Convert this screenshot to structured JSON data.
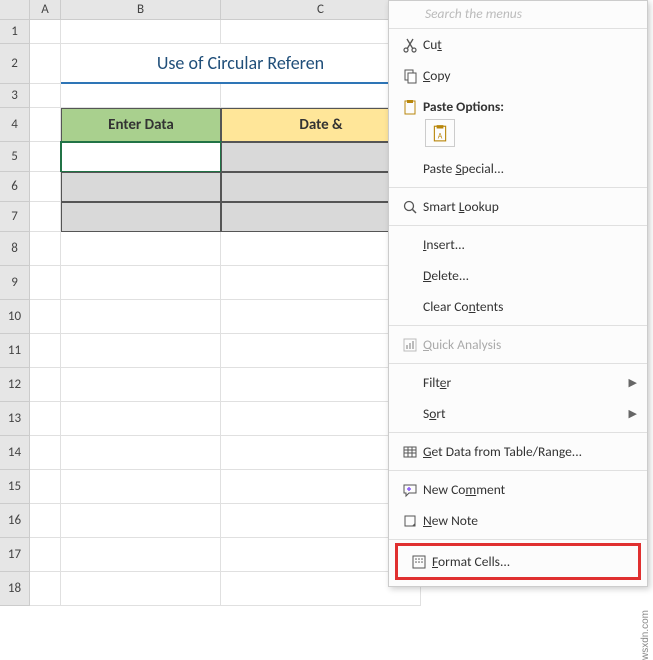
{
  "columns": [
    "A",
    "B",
    "C"
  ],
  "rows": [
    1,
    2,
    3,
    4,
    5,
    6,
    7,
    8,
    9,
    10,
    11,
    12,
    13,
    14,
    15,
    16,
    17,
    18
  ],
  "title": "Use of Circular Referen",
  "table": {
    "headers": {
      "b": "Enter Data",
      "c": "Date &"
    }
  },
  "menu": {
    "search_placeholder": "Search the menus",
    "cut": "Cut",
    "copy": "Copy",
    "paste_options": "Paste Options:",
    "paste_special": "Paste Special...",
    "smart_lookup": "Smart Lookup",
    "insert": "Insert...",
    "delete": "Delete...",
    "clear_contents": "Clear Contents",
    "quick_analysis": "Quick Analysis",
    "filter": "Filter",
    "sort": "Sort",
    "get_data": "Get Data from Table/Range...",
    "new_comment": "New Comment",
    "new_note": "New Note",
    "format_cells": "Format Cells..."
  },
  "underlines": {
    "cut": "t",
    "copy": "C",
    "paste_special": "S",
    "smart_lookup": "L",
    "insert": "I",
    "delete": "D",
    "clear_contents": "N",
    "quick_analysis": "Q",
    "filter": "E",
    "sort": "O",
    "get_data": "G",
    "new_comment": "M",
    "new_note": "N",
    "format_cells": "F"
  },
  "watermark": "wsxdn.com"
}
